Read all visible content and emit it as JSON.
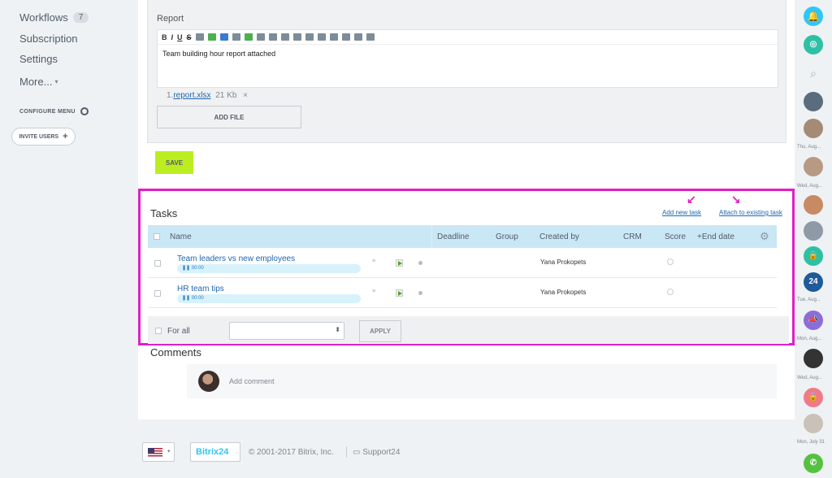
{
  "sidebar": {
    "items": [
      {
        "label": "Workflows",
        "count": "7"
      },
      {
        "label": "Subscription"
      },
      {
        "label": "Settings"
      },
      {
        "label": "More..."
      }
    ],
    "configure_menu": "CONFIGURE MENU",
    "invite_users": "INVITE USERS"
  },
  "report": {
    "label": "Report",
    "toolbar": [
      "B",
      "I",
      "U",
      "S"
    ],
    "content": "Team building hour report attached",
    "file_index": "1.",
    "file_name": "report.xlsx",
    "file_size": "21 Kb",
    "file_remove": "×",
    "add_file": "ADD FILE"
  },
  "save_label": "SAVE",
  "tasks": {
    "title": "Tasks",
    "add_new": "Add new task",
    "attach_existing": "Attach to existing task",
    "columns": [
      "Name",
      "Deadline",
      "Group",
      "Created by",
      "CRM",
      "Score",
      "End date"
    ],
    "rows": [
      {
        "name": "Team leaders vs new employees",
        "timer": "00:00",
        "created_by": "Yana Prokopets"
      },
      {
        "name": "HR team tips",
        "timer": "00:00",
        "created_by": "Yana Prokopets"
      }
    ],
    "for_all": "For all",
    "apply": "APPLY"
  },
  "comments": {
    "title": "Comments",
    "placeholder": "Add comment"
  },
  "footer": {
    "logo": "Bitrix24",
    "copyright": "© 2001-2017 Bitrix, Inc.",
    "support": "Support24"
  },
  "rightbar": {
    "dates": [
      "Thu, Aug...",
      "Wed, Aug...",
      "Tue, Aug...",
      "Mon, Aug...",
      "Wed, Aug...",
      "Mon, July 31"
    ],
    "badge_24": "24"
  },
  "colors": {
    "accent_highlight": "#e21ec5",
    "save_button": "#bbed21",
    "link": "#2067b0",
    "table_header": "#c9e7f5"
  }
}
